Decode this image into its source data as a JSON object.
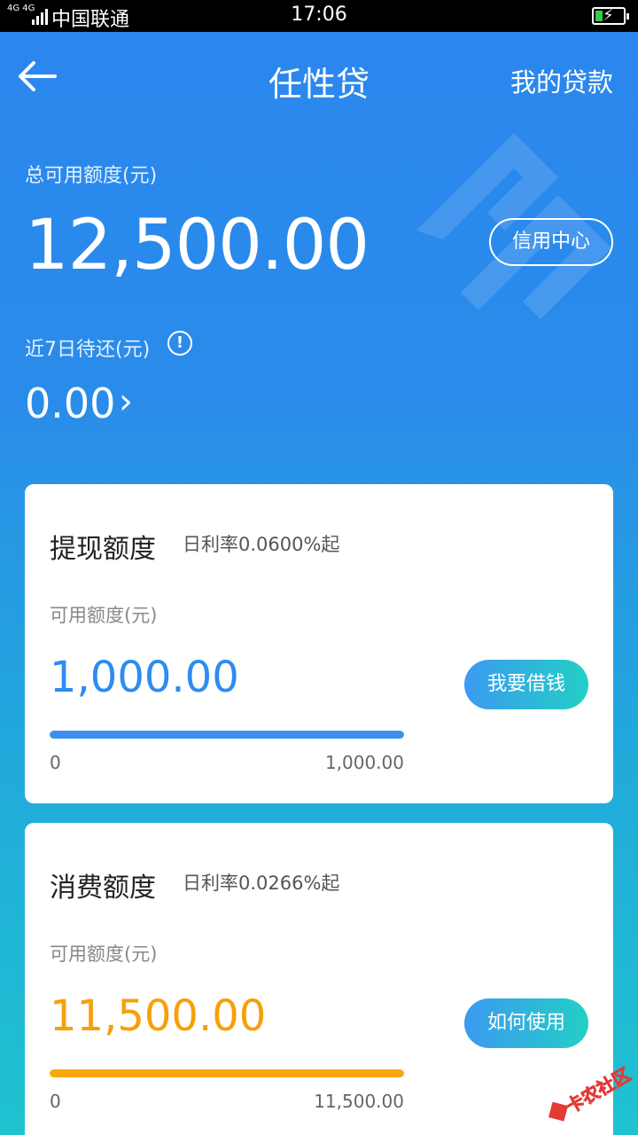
{
  "status_bar": {
    "network": "4G 4G",
    "carrier": "中国联通",
    "time": "17:06"
  },
  "header": {
    "title": "任性贷",
    "back_icon": "arrow-left-icon",
    "right_link": "我的贷款"
  },
  "summary": {
    "total_label": "总可用额度(元)",
    "total_value": "12,500.00",
    "credit_center_button": "信用中心",
    "due_label": "近7日待还(元)",
    "due_info_icon": "!",
    "due_value": "0.00",
    "due_chevron": "›"
  },
  "cards": [
    {
      "title": "提现额度",
      "rate": "日利率0.0600%起",
      "available_label": "可用额度(元)",
      "available_value": "1,000.00",
      "button": "我要借钱",
      "progress": 1.0,
      "range_min": "0",
      "range_max": "1,000.00",
      "accent_color": "#2d8cf0"
    },
    {
      "title": "消费额度",
      "rate": "日利率0.0266%起",
      "available_label": "可用额度(元)",
      "available_value": "11,500.00",
      "button": "如何使用",
      "progress": 1.0,
      "range_min": "0",
      "range_max": "11,500.00",
      "accent_color": "#f6a00b"
    }
  ],
  "watermark_brand": "卡农社区",
  "colors": {
    "background_top": "#2b86ee",
    "background_bottom": "#1fc3cf",
    "button_gradient_start": "#3b9af1",
    "button_gradient_end": "#23cfc5"
  }
}
